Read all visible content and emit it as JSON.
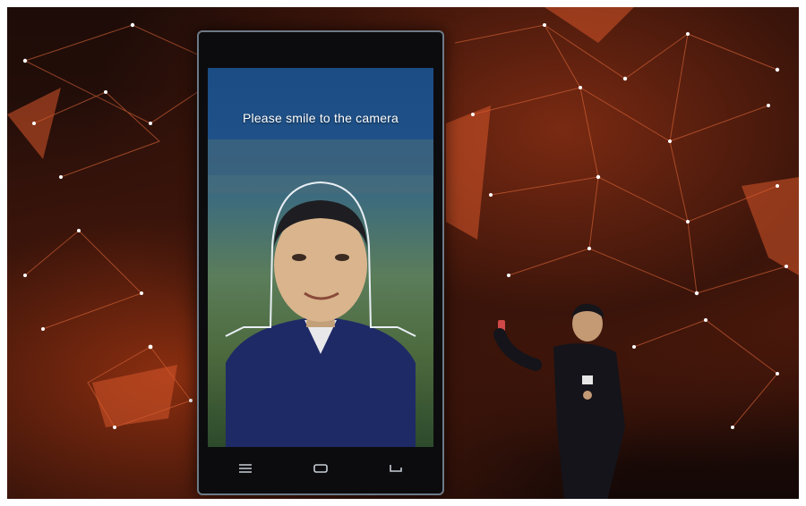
{
  "screen": {
    "prompt": "Please smile to the camera"
  },
  "phone_nav": {
    "menu_icon": "menu-icon",
    "home_icon": "home-icon",
    "back_icon": "back-icon"
  },
  "colors": {
    "background_red": "#c0401a",
    "node_white": "#ffffff",
    "face_outline": "#e8eef4"
  }
}
